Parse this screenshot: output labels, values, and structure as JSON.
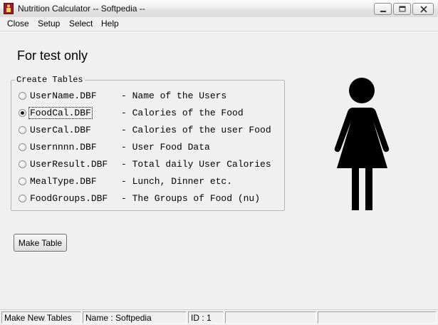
{
  "window": {
    "title": "Nutrition Calculator -- Softpedia --"
  },
  "menu": [
    {
      "label": "Close"
    },
    {
      "label": "Setup"
    },
    {
      "label": "Select"
    },
    {
      "label": "Help"
    }
  ],
  "heading": "For test only",
  "group": {
    "label": "Create Tables",
    "options": [
      {
        "file": "UserName.DBF",
        "desc": "- Name of the Users",
        "checked": false
      },
      {
        "file": "FoodCal.DBF",
        "desc": "- Calories of the Food",
        "checked": true
      },
      {
        "file": "UserCal.DBF",
        "desc": "- Calories of the user Food",
        "checked": false
      },
      {
        "file": "Usernnnn.DBF",
        "desc": "- User Food Data",
        "checked": false
      },
      {
        "file": "UserResult.DBF",
        "desc": "- Total daily User Calories",
        "checked": false
      },
      {
        "file": "MealType.DBF",
        "desc": "- Lunch, Dinner etc.",
        "checked": false
      },
      {
        "file": "FoodGroups.DBF",
        "desc": "- The Groups of Food (nu)",
        "checked": false
      }
    ]
  },
  "make_button": "Make Table",
  "icons": {
    "app": "app-icon",
    "figure": "woman-figure-icon",
    "minimize": "minimize-icon",
    "maximize": "maximize-icon",
    "close": "close-icon"
  },
  "status": {
    "message": "Make New Tables",
    "name": "Name : Softpedia",
    "id": "ID : 1",
    "extra1": "",
    "extra2": ""
  },
  "colors": {
    "app_icon": "#9b1d2b",
    "figure": "#000000"
  }
}
